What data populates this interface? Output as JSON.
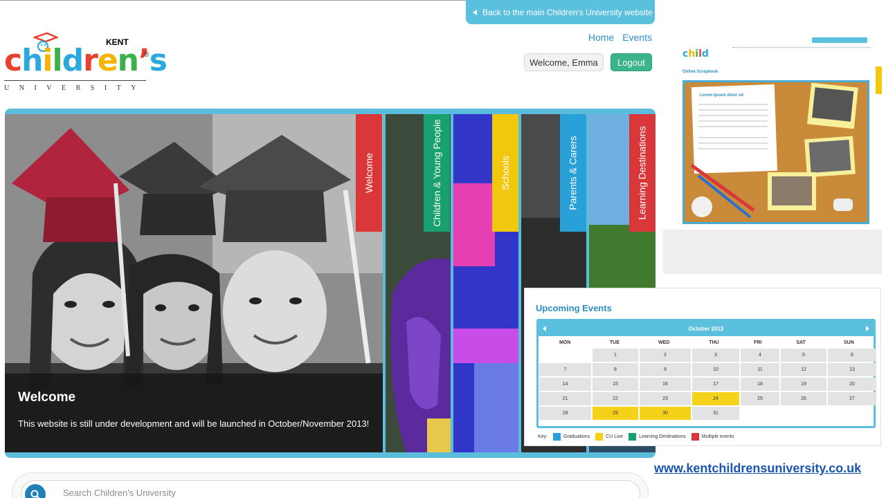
{
  "header": {
    "back_link": "Back to the main Children's University website",
    "nav": [
      "Home",
      "Events"
    ],
    "welcome": "Welcome, Emma",
    "logout": "Logout"
  },
  "logo": {
    "region": "KENT",
    "letters": [
      "c",
      "h",
      "i",
      "l",
      "d",
      "r",
      "e",
      "n",
      "’",
      "s"
    ],
    "letter_colors": [
      "#e8402f",
      "#2aa9df",
      "#f5b400",
      "#3cb04a",
      "#2aa9df",
      "#e8402f",
      "#f5b400",
      "#3cb04a",
      "#e8402f",
      "#2aa9df"
    ],
    "registered": "®",
    "subtitle": "UNIVERSITY"
  },
  "hero": {
    "caption_title": "Welcome",
    "caption_text": "This website is still under development and will be launched in October/November 2013!",
    "tabs": [
      {
        "label": "Welcome",
        "color": "#d9373a"
      },
      {
        "label": "Children & Young People",
        "color": "#18a06f"
      },
      {
        "label": "Schools",
        "color": "#f2c80f"
      },
      {
        "label": "Parents & Carers",
        "color": "#2aa0d8"
      },
      {
        "label": "Learning Destinations",
        "color": "#d9373a"
      }
    ]
  },
  "scrapbook": {
    "label": "Online Scrapbook",
    "note_title": "Lorem Ipsum dolor sit"
  },
  "events": {
    "title": "Upcoming Events",
    "month": "October 2013",
    "days": [
      "MON",
      "TUE",
      "WED",
      "THU",
      "FRI",
      "SAT",
      "SUN"
    ],
    "weeks": [
      [
        "",
        "1",
        "2",
        "3",
        "4",
        "5",
        "6"
      ],
      [
        "7",
        "8",
        "9",
        "10",
        "11",
        "12",
        "13"
      ],
      [
        "14",
        "15",
        "16",
        "17",
        "18",
        "19",
        "20"
      ],
      [
        "21",
        "22",
        "23",
        "24",
        "25",
        "26",
        "27"
      ],
      [
        "28",
        "29",
        "30",
        "31",
        "",
        "",
        ""
      ]
    ],
    "cu_live_days": [
      "24",
      "29",
      "30"
    ],
    "key_label": "Key:",
    "key": [
      {
        "label": "Graduations",
        "color": "#2aa0d8"
      },
      {
        "label": "CU Live",
        "color": "#f5d21a"
      },
      {
        "label": "Learning Destinations",
        "color": "#18a06f"
      },
      {
        "label": "Multiple events",
        "color": "#d9373a"
      }
    ]
  },
  "site_url": "www.kentchildrensuniversity.co.uk",
  "search": {
    "placeholder": "Search Children's University"
  }
}
